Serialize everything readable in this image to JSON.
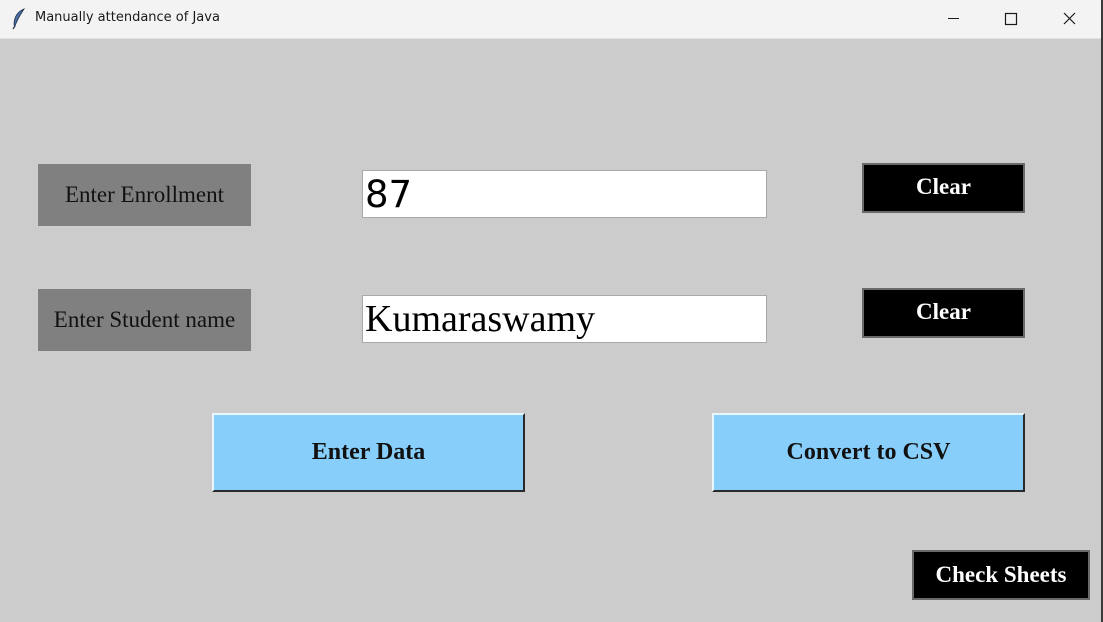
{
  "window": {
    "title": "Manually attendance of Java",
    "controls": {
      "minimize_icon": "minimize-icon",
      "maximize_icon": "maximize-icon",
      "close_icon": "close-icon"
    }
  },
  "form": {
    "enrollment_label": "Enter Enrollment",
    "enrollment_value": "87",
    "name_label": "Enter Student name",
    "name_value": "Kumaraswamy",
    "clear_enrollment_label": "Clear",
    "clear_name_label": "Clear"
  },
  "actions": {
    "enter_data_label": "Enter Data",
    "convert_csv_label": "Convert to CSV",
    "check_sheets_label": "Check Sheets"
  },
  "colors": {
    "window_bg": "#cccccc",
    "label_bg": "#808080",
    "clear_bg": "#000000",
    "action_bg": "#87cefa"
  }
}
